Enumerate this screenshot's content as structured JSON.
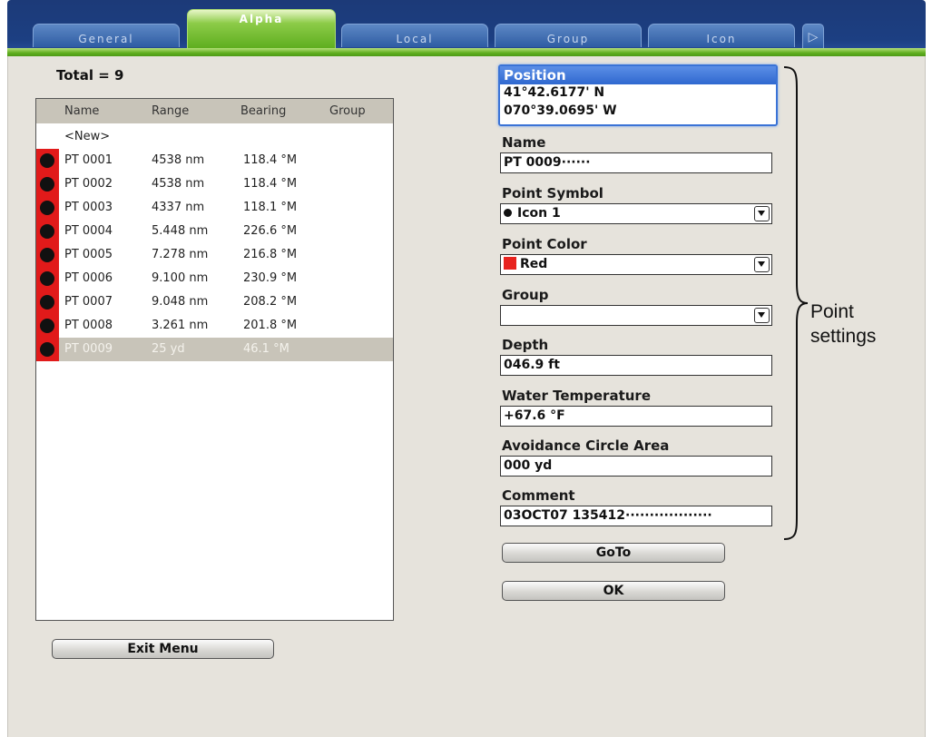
{
  "tabs": [
    {
      "label": "General",
      "active": false
    },
    {
      "label": "Alpha",
      "active": true
    },
    {
      "label": "Local",
      "active": false
    },
    {
      "label": "Group",
      "active": false
    },
    {
      "label": "Icon",
      "active": false
    }
  ],
  "tab_scroll_glyph": "▷",
  "total_label": "Total = 9",
  "list": {
    "columns": [
      "Name",
      "Range",
      "Bearing",
      "Group"
    ],
    "new_entry": "<New>",
    "rows": [
      {
        "name": "PT 0001",
        "range": "4538 nm",
        "bearing": "118.4 °M",
        "group": ""
      },
      {
        "name": "PT 0002",
        "range": "4538 nm",
        "bearing": "118.4 °M",
        "group": ""
      },
      {
        "name": "PT 0003",
        "range": "4337 nm",
        "bearing": "118.1 °M",
        "group": ""
      },
      {
        "name": "PT 0004",
        "range": "5.448 nm",
        "bearing": "226.6 °M",
        "group": ""
      },
      {
        "name": "PT 0005",
        "range": "7.278 nm",
        "bearing": "216.8 °M",
        "group": ""
      },
      {
        "name": "PT 0006",
        "range": "9.100 nm",
        "bearing": "230.9 °M",
        "group": ""
      },
      {
        "name": "PT 0007",
        "range": "9.048 nm",
        "bearing": "208.2 °M",
        "group": ""
      },
      {
        "name": "PT 0008",
        "range": "3.261 nm",
        "bearing": "201.8 °M",
        "group": ""
      },
      {
        "name": "PT 0009",
        "range": "25 yd",
        "bearing": "46.1 °M",
        "group": "",
        "selected": true
      }
    ]
  },
  "exit_menu_label": "Exit Menu",
  "settings": {
    "position": {
      "label": "Position",
      "lat": "41°42.6177' N",
      "lon": "070°39.0695' W"
    },
    "name": {
      "label": "Name",
      "value": "PT 0009······"
    },
    "point_symbol": {
      "label": "Point Symbol",
      "value": "Icon 1"
    },
    "point_color": {
      "label": "Point Color",
      "value": "Red"
    },
    "group": {
      "label": "Group",
      "value": ""
    },
    "depth": {
      "label": "Depth",
      "value": "046.9 ft"
    },
    "water_temperature": {
      "label": "Water Temperature",
      "value": "+67.6 °F"
    },
    "avoidance_circle_area": {
      "label": "Avoidance Circle Area",
      "value": "000 yd"
    },
    "comment": {
      "label": "Comment",
      "value": "03OCT07 135412··················"
    }
  },
  "goto_label": "GoTo",
  "ok_label": "OK",
  "callout": {
    "line1": "Point",
    "line2": "settings"
  },
  "colors": {
    "symbol_background": "#e11a1a",
    "symbol_dot": "#111111",
    "active_tab": "#5fae1f",
    "tab_bar": "#1c3f82",
    "panel": "#e6e3dc"
  }
}
